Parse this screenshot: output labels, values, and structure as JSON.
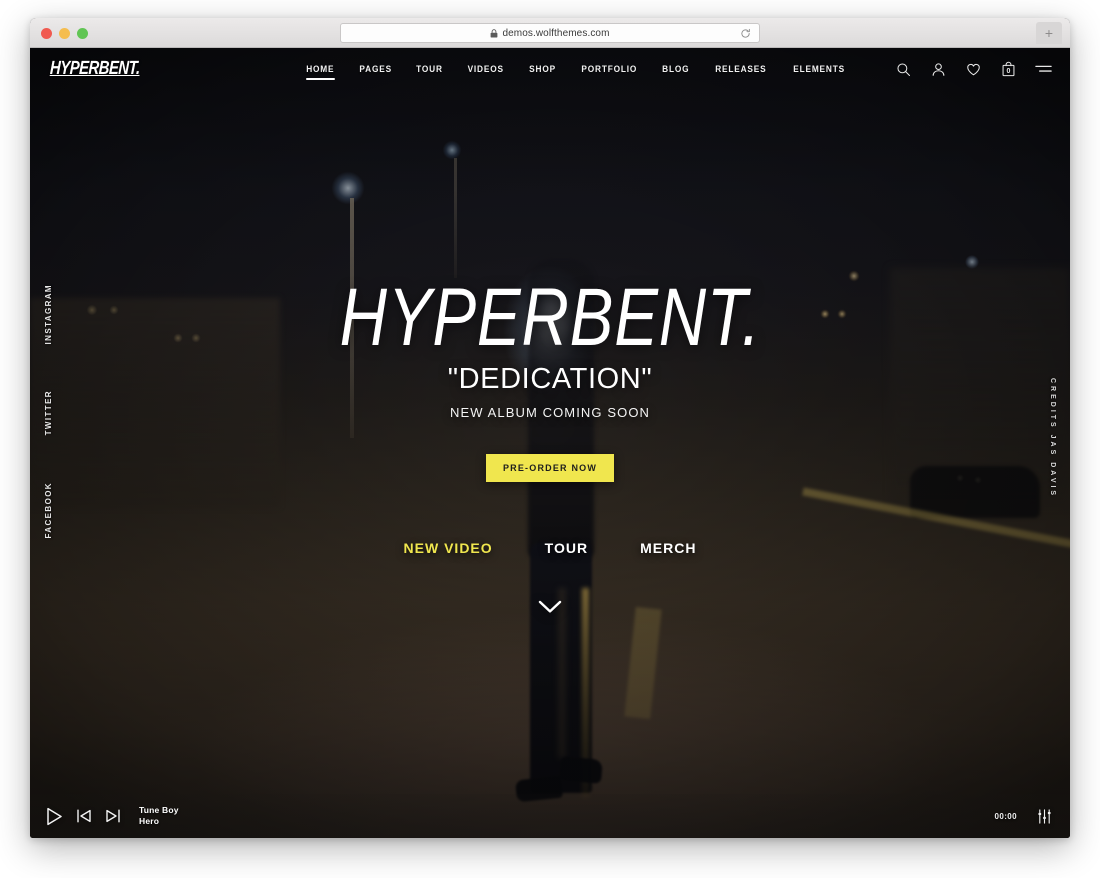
{
  "browser": {
    "url": "demos.wolfthemes.com",
    "lock_icon": "lock-icon",
    "reload_icon": "reload-icon",
    "new_tab_label": "+",
    "traffic_lights": [
      "close-red",
      "minimize-yellow",
      "maximize-green"
    ]
  },
  "header": {
    "logo": "HYPERBENT.",
    "nav": [
      {
        "label": "HOME",
        "active": true
      },
      {
        "label": "PAGES",
        "active": false
      },
      {
        "label": "TOUR",
        "active": false
      },
      {
        "label": "VIDEOS",
        "active": false
      },
      {
        "label": "SHOP",
        "active": false
      },
      {
        "label": "PORTFOLIO",
        "active": false
      },
      {
        "label": "BLOG",
        "active": false
      },
      {
        "label": "RELEASES",
        "active": false
      },
      {
        "label": "ELEMENTS",
        "active": false
      }
    ],
    "icons": [
      {
        "name": "search-icon"
      },
      {
        "name": "account-icon"
      },
      {
        "name": "wishlist-heart-icon"
      },
      {
        "name": "cart-bag-icon",
        "count": "0"
      },
      {
        "name": "hamburger-menu-icon"
      }
    ]
  },
  "side_left": {
    "items": [
      {
        "label": "INSTAGRAM"
      },
      {
        "label": "TWITTER"
      },
      {
        "label": "FACEBOOK"
      }
    ]
  },
  "side_right": {
    "credits": "CREDITS JAS DAVIS"
  },
  "hero": {
    "title": "HYPERBENT.",
    "subtitle": "\"DEDICATION\"",
    "tagline": "NEW ALBUM COMING SOON",
    "cta_label": "PRE-ORDER NOW",
    "quick_links": [
      {
        "label": "NEW VIDEO",
        "accent": true
      },
      {
        "label": "TOUR",
        "accent": false
      },
      {
        "label": "MERCH",
        "accent": false
      }
    ],
    "scroll_icon": "chevron-down-icon"
  },
  "player": {
    "play_icon": "play-icon",
    "prev_icon": "previous-track-icon",
    "next_icon": "next-track-icon",
    "artist": "Tune Boy",
    "track": "Hero",
    "time": "00:00",
    "equalizer_icon": "equalizer-sliders-icon"
  },
  "colors": {
    "accent_yellow": "#f0e64e",
    "text_white": "#ffffff",
    "dark_bg": "#15161d"
  }
}
